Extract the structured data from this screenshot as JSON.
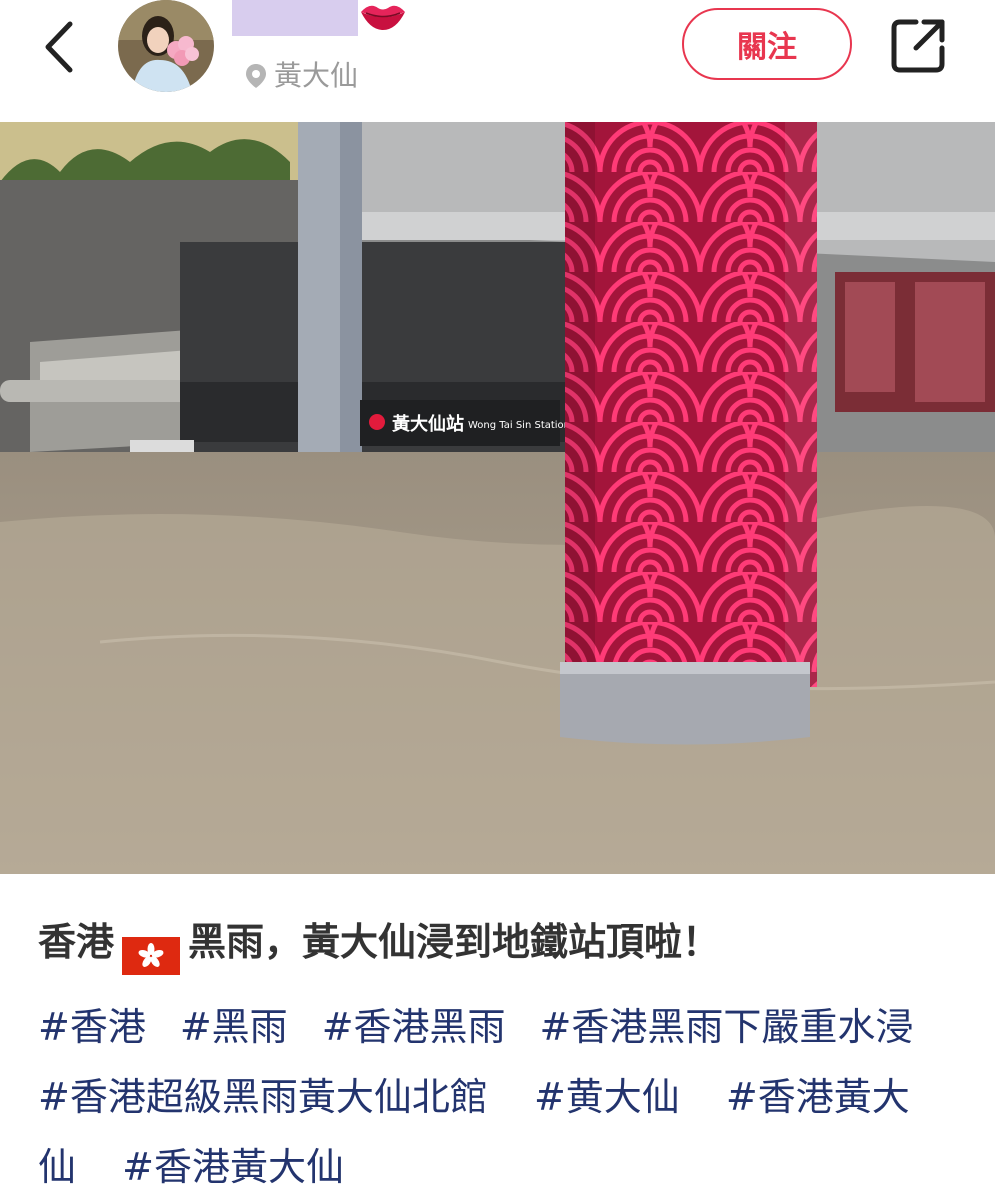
{
  "header": {
    "back_icon": "chevron-left-icon",
    "avatar_alt": "avatar",
    "username_emoji_icon": "lips-icon",
    "location": "黃大仙",
    "location_icon": "location-pin-icon",
    "follow_label": "關注",
    "share_icon": "share-icon",
    "accent_color": "#e8364f"
  },
  "photo": {
    "sign_text": "黃大仙站",
    "sign_text_en": "Wong Tai Sin Station"
  },
  "post": {
    "title_part1": "香港",
    "flag_icon": "hong-kong-flag-icon",
    "title_part2": "黑雨，黃大仙浸到地鐵站頂啦！",
    "tags": [
      "#香港",
      "#黑雨",
      "#香港黑雨",
      "#香港黑雨下嚴重水浸",
      "#香港超級黑雨黃大仙北館",
      "#黄大仙",
      "#香港黃大仙",
      "#香港黃大仙"
    ],
    "tag_color": "#23346e"
  }
}
